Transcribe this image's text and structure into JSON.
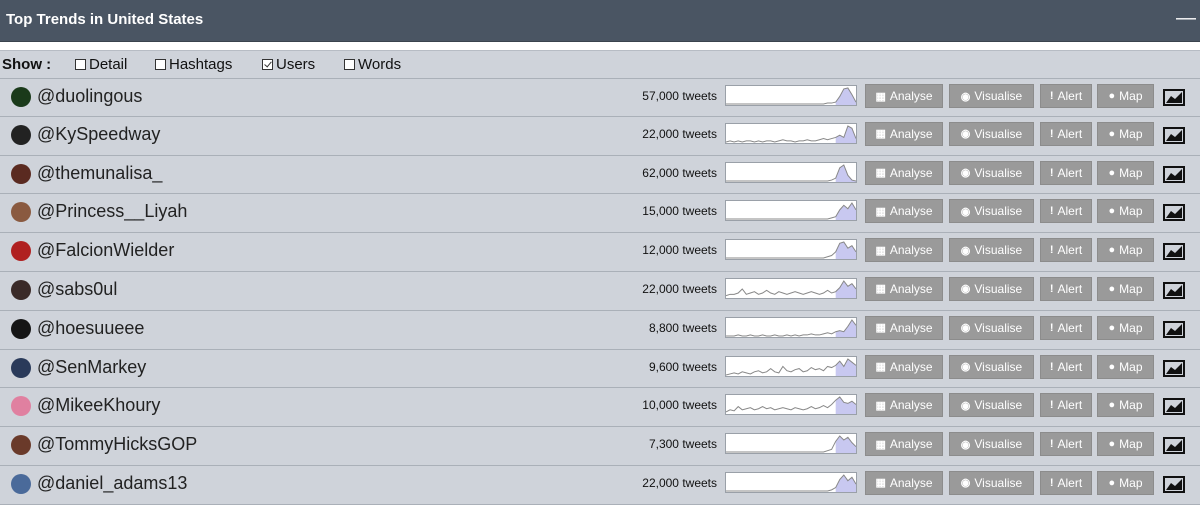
{
  "header": {
    "title": "Top Trends in United States",
    "collapse_symbol": "—"
  },
  "show": {
    "label": "Show :",
    "options": [
      {
        "label": "Detail",
        "checked": false
      },
      {
        "label": "Hashtags",
        "checked": false
      },
      {
        "label": "Users",
        "checked": true
      },
      {
        "label": "Words",
        "checked": false
      }
    ]
  },
  "buttons": {
    "analyse": "Analyse",
    "visualise": "Visualise",
    "alert": "Alert",
    "map": "Map"
  },
  "icons": {
    "analyse": "table-icon",
    "visualise": "eye-icon",
    "alert": "exclamation-icon",
    "map": "globe-icon",
    "chart": "area-chart-icon"
  },
  "colors": {
    "header_bg": "#4a5563",
    "row_bg": "#cfd3da",
    "button_bg": "#9a9a9a",
    "spark_fill": "#c8c8f0",
    "spark_line": "#888888"
  },
  "trends": [
    {
      "handle": "@duolingous",
      "tweets": "57,000 tweets",
      "avatar_color": "#1a3a1a",
      "spark": [
        0,
        0,
        0,
        0,
        0,
        0,
        0,
        0,
        0,
        0,
        0,
        0,
        0,
        0,
        0,
        0,
        0,
        0,
        0,
        0,
        0,
        0,
        0,
        0,
        0,
        1,
        1,
        2,
        8,
        16,
        17,
        10,
        2
      ]
    },
    {
      "handle": "@KySpeedway",
      "tweets": "22,000 tweets",
      "avatar_color": "#222222",
      "spark": [
        0,
        1,
        0,
        1,
        0,
        1,
        1,
        0,
        1,
        0,
        1,
        1,
        0,
        1,
        2,
        1,
        1,
        0,
        1,
        1,
        2,
        1,
        1,
        2,
        3,
        2,
        3,
        4,
        6,
        4,
        14,
        12,
        3
      ]
    },
    {
      "handle": "@themunalisa_",
      "tweets": "62,000 tweets",
      "avatar_color": "#5a2a20",
      "spark": [
        0,
        0,
        0,
        0,
        0,
        0,
        0,
        0,
        0,
        0,
        0,
        0,
        0,
        0,
        0,
        0,
        0,
        0,
        0,
        0,
        0,
        0,
        0,
        0,
        0,
        0,
        1,
        3,
        14,
        17,
        6,
        1,
        0
      ]
    },
    {
      "handle": "@Princess__Liyah",
      "tweets": "15,000 tweets",
      "avatar_color": "#8a5a40",
      "spark": [
        0,
        0,
        0,
        0,
        0,
        0,
        0,
        0,
        0,
        0,
        0,
        0,
        0,
        0,
        0,
        0,
        0,
        0,
        0,
        0,
        0,
        0,
        0,
        0,
        0,
        0,
        1,
        2,
        8,
        12,
        9,
        14,
        8
      ]
    },
    {
      "handle": "@FalcionWielder",
      "tweets": "12,000 tweets",
      "avatar_color": "#b02020",
      "spark": [
        0,
        0,
        0,
        0,
        0,
        0,
        0,
        0,
        0,
        0,
        0,
        0,
        0,
        0,
        0,
        0,
        0,
        0,
        0,
        0,
        0,
        0,
        0,
        0,
        0,
        1,
        2,
        5,
        12,
        13,
        8,
        10,
        5
      ]
    },
    {
      "handle": "@sabs0ul",
      "tweets": "22,000 tweets",
      "avatar_color": "#3a2a28",
      "spark": [
        1,
        2,
        2,
        3,
        6,
        2,
        3,
        4,
        2,
        3,
        5,
        3,
        2,
        4,
        3,
        2,
        3,
        4,
        3,
        2,
        3,
        4,
        3,
        2,
        3,
        5,
        3,
        4,
        7,
        12,
        8,
        10,
        6
      ]
    },
    {
      "handle": "@hoesuueee",
      "tweets": "8,800 tweets",
      "avatar_color": "#151515",
      "spark": [
        0,
        0,
        0,
        1,
        0,
        0,
        1,
        0,
        0,
        1,
        0,
        0,
        1,
        0,
        0,
        1,
        0,
        1,
        0,
        1,
        1,
        2,
        1,
        1,
        2,
        3,
        2,
        4,
        5,
        4,
        9,
        15,
        10
      ]
    },
    {
      "handle": "@SenMarkey",
      "tweets": "9,600 tweets",
      "avatar_color": "#2a3a5a",
      "spark": [
        0,
        1,
        2,
        1,
        3,
        2,
        1,
        3,
        4,
        2,
        3,
        6,
        3,
        2,
        8,
        4,
        3,
        5,
        6,
        3,
        4,
        7,
        5,
        6,
        4,
        8,
        7,
        9,
        13,
        8,
        15,
        12,
        9
      ]
    },
    {
      "handle": "@MikeeKhoury",
      "tweets": "10,000 tweets",
      "avatar_color": "#e080a0",
      "spark": [
        1,
        3,
        2,
        6,
        3,
        4,
        5,
        3,
        4,
        6,
        4,
        5,
        3,
        4,
        5,
        4,
        3,
        5,
        4,
        3,
        4,
        6,
        4,
        5,
        7,
        5,
        8,
        12,
        15,
        10,
        9,
        11,
        8
      ]
    },
    {
      "handle": "@TommyHicksGOP",
      "tweets": "7,300 tweets",
      "avatar_color": "#6a3a2a",
      "spark": [
        0,
        0,
        0,
        0,
        0,
        0,
        0,
        0,
        0,
        0,
        0,
        0,
        0,
        0,
        0,
        0,
        0,
        0,
        0,
        0,
        0,
        0,
        0,
        0,
        0,
        1,
        2,
        8,
        12,
        9,
        11,
        7,
        4
      ]
    },
    {
      "handle": "@daniel_adams13",
      "tweets": "22,000 tweets",
      "avatar_color": "#4a6a9a",
      "spark": [
        0,
        0,
        0,
        0,
        0,
        0,
        0,
        0,
        0,
        0,
        0,
        0,
        0,
        0,
        0,
        0,
        0,
        0,
        0,
        0,
        0,
        0,
        0,
        0,
        0,
        0,
        1,
        3,
        10,
        14,
        9,
        12,
        6
      ]
    }
  ]
}
